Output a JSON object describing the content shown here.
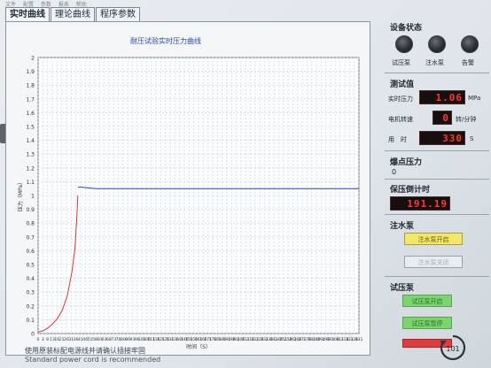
{
  "menu_strip": [
    "文件",
    "配置",
    "参数",
    "报表",
    "帮助"
  ],
  "tabs": [
    {
      "label": "实时曲线"
    },
    {
      "label": "理论曲线"
    },
    {
      "label": "程序参数"
    }
  ],
  "chart_data": {
    "type": "line",
    "title": "耐压试验实时压力曲线",
    "xlabel": "时间（S）",
    "ylabel": "压力（MPa）",
    "xlim": [
      0,
      331
    ],
    "ylim": [
      0,
      2
    ],
    "x_ticks": [
      "0",
      "3",
      "8",
      "13",
      "16",
      "21",
      "26",
      "31",
      "36",
      "41",
      "46",
      "51",
      "56",
      "60",
      "63",
      "68",
      "73",
      "76",
      "80",
      "86",
      "93",
      "96",
      "101",
      "106",
      "111",
      "116",
      "121",
      "126",
      "131",
      "136",
      "141",
      "146",
      "151",
      "156",
      "161",
      "166",
      "171",
      "176",
      "181",
      "186",
      "191",
      "196",
      "201",
      "206",
      "211",
      "216",
      "221",
      "226",
      "231",
      "236",
      "241",
      "246",
      "251",
      "256",
      "261",
      "266",
      "271",
      "276",
      "281",
      "286",
      "291",
      "296",
      "301",
      "306",
      "311",
      "316",
      "321",
      "326",
      "331"
    ],
    "x_tick_display": [
      "0",
      "3",
      "8",
      "13",
      "16",
      "21",
      "26",
      "31",
      "36",
      "41",
      "46",
      "51",
      "56",
      "60",
      "63",
      "68",
      "73",
      "76",
      "80",
      "86",
      "93",
      "96",
      "101",
      "106",
      "111",
      "116",
      "121",
      "126",
      "131",
      "136",
      "141",
      "146",
      "151",
      "156",
      "161",
      "166",
      "171",
      "176",
      "181",
      "186",
      "191",
      "196",
      "201",
      "206",
      "211",
      "216",
      "221",
      "226",
      "231",
      "236",
      "241",
      "246",
      "251",
      "256",
      "261",
      "266",
      "271",
      "276",
      "281",
      "286",
      "291",
      "296",
      "301",
      "306",
      "311",
      "316",
      "321",
      "326",
      "331"
    ],
    "y_ticks": [
      "0",
      "0.1",
      "0.2",
      "0.3",
      "0.4",
      "0.5",
      "0.6",
      "0.7",
      "0.8",
      "0.9",
      "1",
      "1.1",
      "1.2",
      "1.3",
      "1.4",
      "1.5",
      "1.6",
      "1.7",
      "1.8",
      "1.9",
      "2"
    ],
    "grid": true,
    "series": [
      {
        "color": "#e0343a",
        "x": [
          0,
          5,
          10,
          15,
          20,
          25,
          30,
          35,
          38,
          40,
          41
        ],
        "y": [
          0.01,
          0.02,
          0.04,
          0.07,
          0.11,
          0.17,
          0.27,
          0.45,
          0.62,
          0.84,
          1.0
        ]
      },
      {
        "color": "#2c3fb0",
        "x": [
          41,
          45,
          60,
          100,
          150,
          200,
          250,
          300,
          331
        ],
        "y": [
          1.06,
          1.06,
          1.05,
          1.05,
          1.05,
          1.05,
          1.05,
          1.05,
          1.05
        ]
      }
    ]
  },
  "right_panel": {
    "device_status": {
      "title": "设备状态",
      "items": [
        {
          "label": "试压泵",
          "icon": "knob-indicator"
        },
        {
          "label": "注水泵",
          "icon": "knob-indicator"
        },
        {
          "label": "告警",
          "icon": "knob-indicator"
        }
      ]
    },
    "measured": {
      "title": "测试值",
      "rows": [
        {
          "label": "实时压力",
          "value": "1.06",
          "unit": "MPa"
        },
        {
          "label": "电机转速",
          "value": "0",
          "unit": "转/分钟"
        },
        {
          "label": "用　时",
          "value": "330",
          "unit": "S"
        }
      ]
    },
    "burst": {
      "title": "爆点压力",
      "value": "0"
    },
    "hold": {
      "title": "保压倒计时",
      "value": "191.19"
    },
    "fill_pump": {
      "title": "注水泵",
      "buttons": [
        {
          "label": "注水泵开启",
          "style": "yellow"
        },
        {
          "label": "注水泵关闭",
          "style": "disabled"
        }
      ]
    },
    "test_pump": {
      "title": "试压泵",
      "buttons": [
        {
          "label": "试压泵开启",
          "style": "green"
        },
        {
          "label": "试压泵暂停",
          "style": "green"
        },
        {
          "label": "",
          "style": "red"
        }
      ]
    }
  },
  "footer": {
    "line1": "使用原装标配电源线并请确认插接牢固",
    "line2": "Standard power cord is recommended"
  },
  "corner_badge": "101"
}
